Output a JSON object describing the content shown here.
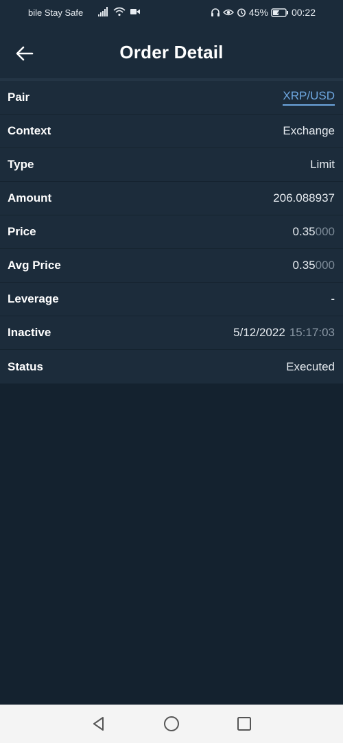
{
  "status_bar": {
    "carrier": "bile Stay Safe",
    "battery": "45%",
    "time": "00:22"
  },
  "header": {
    "title": "Order Detail"
  },
  "details": [
    {
      "label": "Pair",
      "value": "XRP/USD"
    },
    {
      "label": "Context",
      "value": "Exchange"
    },
    {
      "label": "Type",
      "value": "Limit"
    },
    {
      "label": "Amount",
      "value": "206.088937"
    },
    {
      "label": "Price",
      "value_main": "0.35",
      "value_dim": "000"
    },
    {
      "label": "Avg Price",
      "value_main": "0.35",
      "value_dim": "000"
    },
    {
      "label": "Leverage",
      "value": "-"
    },
    {
      "label": "Inactive",
      "date": "5/12/2022",
      "time": "15:17:03"
    },
    {
      "label": "Status",
      "value": "Executed"
    }
  ],
  "colors": {
    "background": "#14222f",
    "panel": "#1c2c3b",
    "link": "#6ea7e0"
  }
}
